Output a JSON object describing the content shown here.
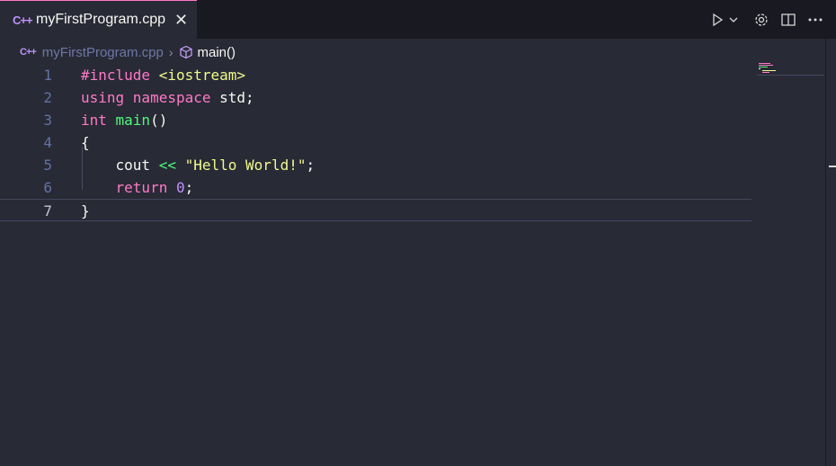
{
  "tab": {
    "icon": "C++",
    "title": "myFirstProgram.cpp",
    "close": "✕"
  },
  "actions": {
    "run": "run-icon",
    "more_run": "chevron-down-icon",
    "settings": "gear-icon",
    "split": "split-editor-icon",
    "more": "ellipsis-icon"
  },
  "breadcrumb": {
    "icon": "C++",
    "file": "myFirstProgram.cpp",
    "separator": "›",
    "symbol": "main()"
  },
  "lines": [
    {
      "n": "1",
      "tokens": [
        {
          "t": "#include ",
          "c": "kw"
        },
        {
          "t": "<iostream>",
          "c": "str"
        }
      ]
    },
    {
      "n": "2",
      "tokens": [
        {
          "t": "using ",
          "c": "kw"
        },
        {
          "t": "namespace ",
          "c": "kw"
        },
        {
          "t": "std",
          "c": "pl"
        },
        {
          "t": ";",
          "c": "pl"
        }
      ]
    },
    {
      "n": "3",
      "tokens": [
        {
          "t": "int ",
          "c": "kw"
        },
        {
          "t": "main",
          "c": "fn"
        },
        {
          "t": "()",
          "c": "pl"
        }
      ]
    },
    {
      "n": "4",
      "tokens": [
        {
          "t": "{",
          "c": "pl"
        }
      ]
    },
    {
      "n": "5",
      "tokens": [
        {
          "t": "    cout ",
          "c": "pl"
        },
        {
          "t": "<< ",
          "c": "fn"
        },
        {
          "t": "\"Hello World!\"",
          "c": "str"
        },
        {
          "t": ";",
          "c": "pl"
        }
      ]
    },
    {
      "n": "6",
      "tokens": [
        {
          "t": "    return ",
          "c": "kw"
        },
        {
          "t": "0",
          "c": "num"
        },
        {
          "t": ";",
          "c": "pl"
        }
      ]
    },
    {
      "n": "7",
      "tokens": [
        {
          "t": "}",
          "c": "pl"
        }
      ]
    }
  ],
  "active_line": 7,
  "colors": {
    "keyword": "#ff79c6",
    "function": "#50fa7b",
    "string": "#f1fa8c",
    "number": "#bd93f9",
    "background": "#282a36"
  }
}
